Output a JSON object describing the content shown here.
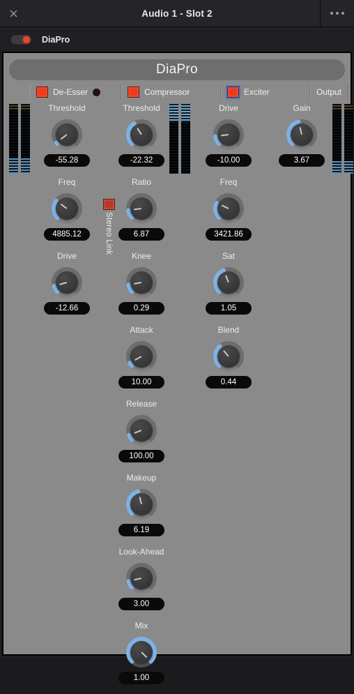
{
  "titlebar": {
    "close_icon": "close-icon",
    "title": "Audio 1 - Slot 2",
    "menu_icon": "more-options-icon"
  },
  "enable_strip": {
    "plugin_name": "DiaPro",
    "power_state": "on"
  },
  "plugin": {
    "title": "DiaPro",
    "accent_color": "#7fb2e5",
    "led_color": "#f03a1e",
    "panel_color": "#8a8a8a"
  },
  "tabs": [
    {
      "label": "De-Esser",
      "has_led": true,
      "led_focused": false,
      "has_dot": true
    },
    {
      "label": "Compressor",
      "has_led": true,
      "led_focused": false,
      "has_dot": false
    },
    {
      "label": "Exciter",
      "has_led": true,
      "led_focused": true,
      "has_dot": false
    },
    {
      "label": "Output",
      "has_led": false,
      "led_focused": false,
      "has_dot": false
    }
  ],
  "stereo_link": {
    "label": "Stereo Link",
    "enabled": true
  },
  "columns": [
    {
      "name": "de-esser",
      "controls": [
        {
          "label": "Threshold",
          "value": "-55.28",
          "arc": 0.03
        },
        {
          "label": "Freq",
          "value": "4885.12",
          "arc": 0.3
        },
        {
          "label": "Drive",
          "value": "-12.66",
          "arc": 0.11
        }
      ]
    },
    {
      "name": "compressor",
      "controls": [
        {
          "label": "Threshold",
          "value": "-22.32",
          "arc": 0.38
        },
        {
          "label": "Ratio",
          "value": "6.87",
          "arc": 0.14
        },
        {
          "label": "Knee",
          "value": "0.29",
          "arc": 0.13
        },
        {
          "label": "Attack",
          "value": "10.00",
          "arc": 0.06
        },
        {
          "label": "Release",
          "value": "100.00",
          "arc": 0.09
        },
        {
          "label": "Makeup",
          "value": "6.19",
          "arc": 0.45
        },
        {
          "label": "Look-Ahead",
          "value": "3.00",
          "arc": 0.12
        },
        {
          "label": "Mix",
          "value": "1.00",
          "arc": 1.0
        }
      ]
    },
    {
      "name": "exciter",
      "controls": [
        {
          "label": "Drive",
          "value": "-10.00",
          "arc": 0.14
        },
        {
          "label": "Freq",
          "value": "3421.86",
          "arc": 0.26
        },
        {
          "label": "Sat",
          "value": "1.05",
          "arc": 0.42
        },
        {
          "label": "Blend",
          "value": "0.44",
          "arc": 0.35
        }
      ]
    },
    {
      "name": "output",
      "controls": [
        {
          "label": "Gain",
          "value": "3.67",
          "arc": 0.45
        }
      ]
    }
  ],
  "meters": {
    "input_left": {
      "top_color": "#4a4228",
      "bottom_color": "#5c90b8",
      "top_pct": 8,
      "bottom_pct": 22
    },
    "gain_reduction": {
      "top_color": "#6fa8cf",
      "bottom_color": "#0b1117",
      "top_pct": 26,
      "bottom_pct": 0
    },
    "output_right": {
      "top_color": "#4a4228",
      "bottom_color": "#5c90b8",
      "top_pct": 8,
      "bottom_pct": 18
    }
  }
}
